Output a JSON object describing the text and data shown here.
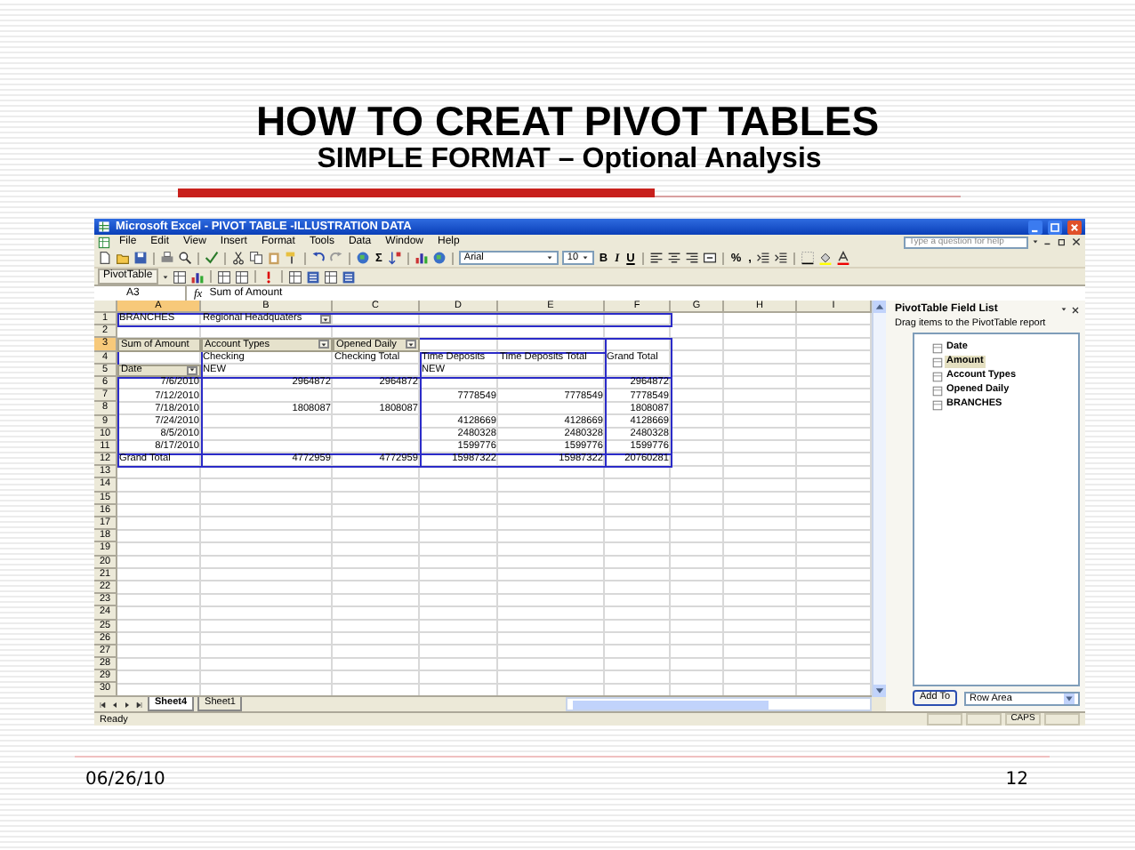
{
  "slide": {
    "title": "HOW TO CREAT PIVOT TABLES",
    "subtitle": "SIMPLE FORMAT – Optional Analysis",
    "date": "06/26/10",
    "page_number": "12"
  },
  "window": {
    "title": "Microsoft Excel - PIVOT TABLE -ILLUSTRATION DATA"
  },
  "menu": [
    "File",
    "Edit",
    "View",
    "Insert",
    "Format",
    "Tools",
    "Data",
    "Window",
    "Help"
  ],
  "help_search": {
    "placeholder": "Type a question for help"
  },
  "toolbar": {
    "autosum": "Σ",
    "font": "Arial",
    "font_size": "10",
    "format_buttons": [
      "B",
      "I",
      "U"
    ],
    "number_buttons": [
      "%",
      ","
    ]
  },
  "pivot_toolbar": {
    "label": "PivotTable"
  },
  "formula_bar": {
    "name_box": "A3",
    "fx": "fx",
    "value": "Sum of Amount"
  },
  "columns": [
    {
      "label": "A",
      "selected": true
    },
    {
      "label": "B",
      "selected": false
    },
    {
      "label": "C",
      "selected": false
    },
    {
      "label": "D",
      "selected": false
    },
    {
      "label": "E",
      "selected": false
    },
    {
      "label": "F",
      "selected": false
    },
    {
      "label": "G",
      "selected": false
    },
    {
      "label": "H",
      "selected": false
    },
    {
      "label": "I",
      "selected": false
    }
  ],
  "rows": [
    {
      "header": "1",
      "selected": false,
      "cells": [
        {
          "kind": "text",
          "text": "BRANCHES"
        },
        {
          "kind": "text",
          "text": "Regional Headquaters",
          "dropdown": true
        }
      ]
    },
    {
      "header": "2",
      "selected": false
    },
    {
      "header": "3",
      "selected": true,
      "cells": [
        {
          "kind": "field",
          "text": "Sum of Amount",
          "dropdown": false
        },
        {
          "kind": "field",
          "text": "Account Types",
          "dropdown": true
        },
        {
          "kind": "field",
          "text": "Opened Daily",
          "dropdown": true
        }
      ]
    },
    {
      "header": "4",
      "selected": false,
      "cells": [
        {
          "kind": "empty"
        },
        {
          "kind": "text",
          "text": "Checking"
        },
        {
          "kind": "text",
          "text": "Checking Total"
        },
        {
          "kind": "text",
          "text": "Time Deposits"
        },
        {
          "kind": "text",
          "text": "Time Deposits Total"
        },
        {
          "kind": "text",
          "text": "Grand Total"
        }
      ]
    },
    {
      "header": "5",
      "selected": false,
      "cells": [
        {
          "kind": "field",
          "text": "Date",
          "dropdown": true
        },
        {
          "kind": "text",
          "text": "NEW"
        },
        {
          "kind": "empty"
        },
        {
          "kind": "text",
          "text": "NEW"
        }
      ]
    },
    {
      "header": "6",
      "selected": false,
      "cells": [
        {
          "kind": "number",
          "text": "7/6/2010"
        },
        {
          "kind": "number",
          "text": "2964872"
        },
        {
          "kind": "number",
          "text": "2964872"
        },
        {
          "kind": "empty"
        },
        {
          "kind": "empty"
        },
        {
          "kind": "number",
          "text": "2964872"
        }
      ]
    },
    {
      "header": "7",
      "selected": false,
      "cells": [
        {
          "kind": "number",
          "text": "7/12/2010"
        },
        {
          "kind": "empty"
        },
        {
          "kind": "empty"
        },
        {
          "kind": "number",
          "text": "7778549"
        },
        {
          "kind": "number",
          "text": "7778549"
        },
        {
          "kind": "number",
          "text": "7778549"
        }
      ]
    },
    {
      "header": "8",
      "selected": false,
      "cells": [
        {
          "kind": "number",
          "text": "7/18/2010"
        },
        {
          "kind": "number",
          "text": "1808087"
        },
        {
          "kind": "number",
          "text": "1808087"
        },
        {
          "kind": "empty"
        },
        {
          "kind": "empty"
        },
        {
          "kind": "number",
          "text": "1808087"
        }
      ]
    },
    {
      "header": "9",
      "selected": false,
      "cells": [
        {
          "kind": "number",
          "text": "7/24/2010"
        },
        {
          "kind": "empty"
        },
        {
          "kind": "empty"
        },
        {
          "kind": "number",
          "text": "4128669"
        },
        {
          "kind": "number",
          "text": "4128669"
        },
        {
          "kind": "number",
          "text": "4128669"
        }
      ]
    },
    {
      "header": "10",
      "selected": false,
      "cells": [
        {
          "kind": "number",
          "text": "8/5/2010"
        },
        {
          "kind": "empty"
        },
        {
          "kind": "empty"
        },
        {
          "kind": "number",
          "text": "2480328"
        },
        {
          "kind": "number",
          "text": "2480328"
        },
        {
          "kind": "number",
          "text": "2480328"
        }
      ]
    },
    {
      "header": "11",
      "selected": false,
      "cells": [
        {
          "kind": "number",
          "text": "8/17/2010"
        },
        {
          "kind": "empty"
        },
        {
          "kind": "empty"
        },
        {
          "kind": "number",
          "text": "1599776"
        },
        {
          "kind": "number",
          "text": "1599776"
        },
        {
          "kind": "number",
          "text": "1599776"
        }
      ]
    },
    {
      "header": "12",
      "selected": false,
      "cells": [
        {
          "kind": "text",
          "text": "Grand Total"
        },
        {
          "kind": "number",
          "text": "4772959"
        },
        {
          "kind": "number",
          "text": "4772959"
        },
        {
          "kind": "number",
          "text": "15987322"
        },
        {
          "kind": "number",
          "text": "15987322"
        },
        {
          "kind": "number",
          "text": "20760281"
        }
      ]
    },
    {
      "header": "13",
      "selected": false
    },
    {
      "header": "14",
      "selected": false
    },
    {
      "header": "15",
      "selected": false
    },
    {
      "header": "16",
      "selected": false
    },
    {
      "header": "17",
      "selected": false
    },
    {
      "header": "18",
      "selected": false
    },
    {
      "header": "19",
      "selected": false
    },
    {
      "header": "20",
      "selected": false
    },
    {
      "header": "21",
      "selected": false
    },
    {
      "header": "22",
      "selected": false
    },
    {
      "header": "23",
      "selected": false
    },
    {
      "header": "24",
      "selected": false
    },
    {
      "header": "25",
      "selected": false
    },
    {
      "header": "26",
      "selected": false
    },
    {
      "header": "27",
      "selected": false
    },
    {
      "header": "28",
      "selected": false
    },
    {
      "header": "29",
      "selected": false
    },
    {
      "header": "30",
      "selected": false
    }
  ],
  "sheet_tabs": [
    {
      "label": "Sheet4",
      "selected": true
    },
    {
      "label": "Sheet1",
      "selected": false
    }
  ],
  "status_bar": {
    "text": "Ready",
    "indicator": "CAPS"
  },
  "field_list": {
    "title": "PivotTable Field List",
    "hint": "Drag items to the PivotTable report",
    "fields": [
      {
        "label": "Date",
        "selected": false
      },
      {
        "label": "Amount",
        "selected": true
      },
      {
        "label": "Account Types",
        "selected": false
      },
      {
        "label": "Opened Daily",
        "selected": false
      },
      {
        "label": "BRANCHES",
        "selected": false
      }
    ],
    "add_button": "Add To",
    "area": "Row Area"
  }
}
